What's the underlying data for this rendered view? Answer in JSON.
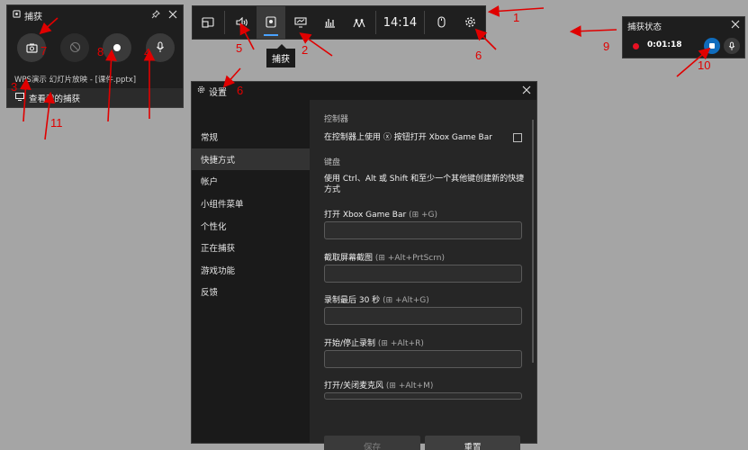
{
  "capture_widget": {
    "title": "捕获",
    "app_name": "WPS演示 幻灯片放映 - [课件.pptx]",
    "view_captures": "查看我的捕获"
  },
  "top_bar": {
    "time": "14:14",
    "tooltip": "捕获"
  },
  "status_widget": {
    "title": "捕获状态",
    "elapsed": "0:01:18"
  },
  "settings": {
    "title": "设置",
    "nav": [
      "常规",
      "快捷方式",
      "帐户",
      "小组件菜单",
      "个性化",
      "正在捕获",
      "游戏功能",
      "反馈"
    ],
    "controller_section": "控制器",
    "controller_option": "在控制器上使用 ⓧ 按钮打开 Xbox Game Bar",
    "keyboard_section": "键盘",
    "keyboard_desc": "使用 Ctrl、Alt 或 Shift 和至少一个其他键创建新的快捷方式",
    "shortcuts": [
      {
        "label": "打开 Xbox Game Bar",
        "hint": "(⊞ +G)"
      },
      {
        "label": "截取屏幕截图",
        "hint": "(⊞ +Alt+PrtScrn)"
      },
      {
        "label": "录制最后 30 秒",
        "hint": "(⊞ +Alt+G)"
      },
      {
        "label": "开始/停止录制",
        "hint": "(⊞ +Alt+R)"
      },
      {
        "label": "打开/关闭麦克风",
        "hint": "(⊞ +Alt+M)"
      }
    ],
    "save_label": "保存",
    "reset_label": "重置"
  },
  "annotations": [
    "1",
    "2",
    "3",
    "4",
    "5",
    "6",
    "6",
    "7",
    "8",
    "9",
    "10",
    "11"
  ],
  "colors": {
    "accent": "#0f6cbd",
    "annotation": "#e00000",
    "record": "#e81123"
  }
}
